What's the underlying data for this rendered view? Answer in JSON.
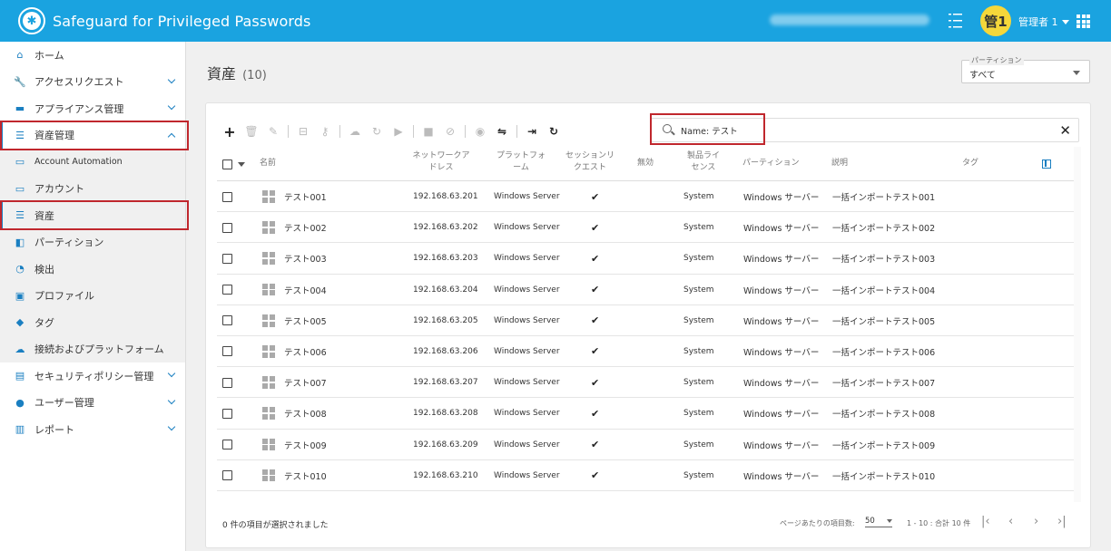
{
  "header": {
    "app_title": "Safeguard for Privileged Passwords",
    "avatar_text": "管1",
    "user_name": "管理者 1"
  },
  "sidebar": {
    "items": [
      {
        "label": "ホーム",
        "icon": "home-icon",
        "chevron": ""
      },
      {
        "label": "アクセスリクエスト",
        "icon": "wrench-icon",
        "chevron": "down"
      },
      {
        "label": "アプライアンス管理",
        "icon": "appliance-icon",
        "chevron": "down"
      },
      {
        "label": "資産管理",
        "icon": "list-icon",
        "chevron": "up"
      },
      {
        "label": "Account Automation",
        "icon": "monitor-icon",
        "chevron": ""
      },
      {
        "label": "アカウント",
        "icon": "monitor-icon",
        "chevron": ""
      },
      {
        "label": "資産",
        "icon": "list-icon",
        "chevron": ""
      },
      {
        "label": "パーティション",
        "icon": "partition-icon",
        "chevron": ""
      },
      {
        "label": "検出",
        "icon": "radar-icon",
        "chevron": ""
      },
      {
        "label": "プロファイル",
        "icon": "profile-icon",
        "chevron": ""
      },
      {
        "label": "タグ",
        "icon": "tag-icon",
        "chevron": ""
      },
      {
        "label": "接続およびプラットフォーム",
        "icon": "cloud-icon",
        "chevron": ""
      },
      {
        "label": "セキュリティポリシー管理",
        "icon": "clipboard-icon",
        "chevron": "down"
      },
      {
        "label": "ユーザー管理",
        "icon": "user-icon",
        "chevron": "down"
      },
      {
        "label": "レポート",
        "icon": "report-icon",
        "chevron": "down"
      }
    ]
  },
  "main": {
    "title": "資産",
    "count": "(10)",
    "partition_label": "パーティション",
    "partition_value": "すべて",
    "search_value": "Name: テスト",
    "columns": {
      "name": "名前",
      "network_address": "ネットワークア\nドレス",
      "platform": "プラットフォ\nーム",
      "session_request": "セッションリ\nクエスト",
      "disabled": "無効",
      "license": "製品ライ\nセンス",
      "partition": "パーティション",
      "description": "説明",
      "tags": "タグ"
    },
    "rows": [
      {
        "name": "テスト001",
        "address": "192.168.63.201",
        "platform": "Windows Server",
        "session": "✔",
        "license": "System",
        "partition": "Windows サーバー",
        "description": "一括インポートテスト001"
      },
      {
        "name": "テスト002",
        "address": "192.168.63.202",
        "platform": "Windows Server",
        "session": "✔",
        "license": "System",
        "partition": "Windows サーバー",
        "description": "一括インポートテスト002"
      },
      {
        "name": "テスト003",
        "address": "192.168.63.203",
        "platform": "Windows Server",
        "session": "✔",
        "license": "System",
        "partition": "Windows サーバー",
        "description": "一括インポートテスト003"
      },
      {
        "name": "テスト004",
        "address": "192.168.63.204",
        "platform": "Windows Server",
        "session": "✔",
        "license": "System",
        "partition": "Windows サーバー",
        "description": "一括インポートテスト004"
      },
      {
        "name": "テスト005",
        "address": "192.168.63.205",
        "platform": "Windows Server",
        "session": "✔",
        "license": "System",
        "partition": "Windows サーバー",
        "description": "一括インポートテスト005"
      },
      {
        "name": "テスト006",
        "address": "192.168.63.206",
        "platform": "Windows Server",
        "session": "✔",
        "license": "System",
        "partition": "Windows サーバー",
        "description": "一括インポートテスト006"
      },
      {
        "name": "テスト007",
        "address": "192.168.63.207",
        "platform": "Windows Server",
        "session": "✔",
        "license": "System",
        "partition": "Windows サーバー",
        "description": "一括インポートテスト007"
      },
      {
        "name": "テスト008",
        "address": "192.168.63.208",
        "platform": "Windows Server",
        "session": "✔",
        "license": "System",
        "partition": "Windows サーバー",
        "description": "一括インポートテスト008"
      },
      {
        "name": "テスト009",
        "address": "192.168.63.209",
        "platform": "Windows Server",
        "session": "✔",
        "license": "System",
        "partition": "Windows サーバー",
        "description": "一括インポートテスト009"
      },
      {
        "name": "テスト010",
        "address": "192.168.63.210",
        "platform": "Windows Server",
        "session": "✔",
        "license": "System",
        "partition": "Windows サーバー",
        "description": "一括インポートテスト010"
      }
    ],
    "footer": {
      "selected": "0 件の項目が選択されました",
      "per_page_label": "ページあたりの項目数:",
      "per_page_value": "50",
      "range": "1 - 10 : 合計 10 件"
    }
  },
  "colors": {
    "header_bg": "#1aa3e0",
    "accent": "#1a7fc1",
    "highlight_box": "#c0272d",
    "avatar_bg": "#f5d73a"
  }
}
